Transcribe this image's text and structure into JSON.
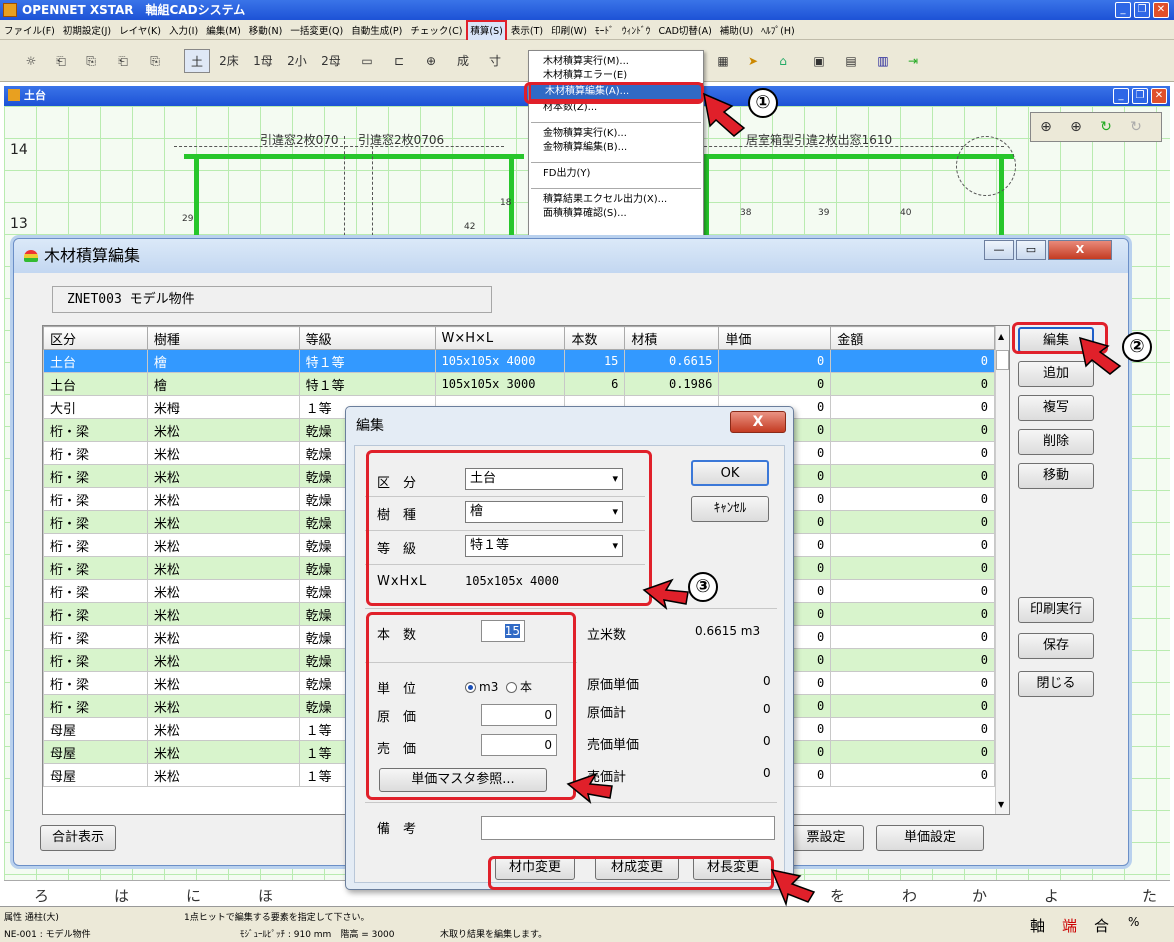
{
  "app": {
    "title": "OPENNET XSTAR　軸組CADシステム"
  },
  "menubar": [
    "ファイル(F)",
    "初期設定(J)",
    "レイヤ(K)",
    "入力(I)",
    "編集(M)",
    "移動(N)",
    "一括変更(Q)",
    "自動生成(P)",
    "チェック(C)",
    "積算(S)",
    "表示(T)",
    "印刷(W)",
    "ﾓｰﾄﾞ",
    "ｳｨﾝﾄﾞｳ",
    "CAD切替(A)",
    "補助(U)",
    "ﾍﾙﾌﾟ(H)"
  ],
  "toolbar": [
    "土",
    "2床",
    "1母",
    "2小",
    "2母",
    "成",
    "寸"
  ],
  "drop_menu": {
    "items": [
      "木材積算実行(M)...",
      "木材積算エラー(E)",
      "木材積算編集(A)...",
      "材本数(Z)...",
      "金物積算実行(K)...",
      "金物積算編集(B)...",
      "FD出力(Y)",
      "積算結果エクセル出力(X)...",
      "面積積算確認(S)..."
    ]
  },
  "doc": {
    "title": "土台"
  },
  "cad": {
    "row_labels": [
      "14",
      "13"
    ],
    "texts": [
      "引違窓2枚070",
      "引違窓2枚0706",
      "居室箱型引違2枚出窓1610"
    ],
    "kana": [
      "ろ",
      "は",
      "に",
      "ほ",
      "を",
      "わ",
      "か",
      "よ",
      "た"
    ],
    "nums": [
      "29",
      "42",
      "38",
      "39",
      "40",
      "18"
    ]
  },
  "zoom_palette": [
    "⊕",
    "⊕",
    "↻",
    "↻"
  ],
  "wood_dialog": {
    "title": "木材積算編集",
    "project": "ZNET003 モデル物件",
    "headers": [
      "区分",
      "樹種",
      "等級",
      "W×H×L",
      "本数",
      "材積",
      "単価",
      "金額"
    ],
    "rows": [
      {
        "kubun": "土台",
        "jushu": "檜",
        "tokyu": "特１等",
        "size": "105x105x 4000",
        "hon": "15",
        "zaiseki": "0.6615",
        "tanka": "0",
        "kingaku": "0"
      },
      {
        "kubun": "土台",
        "jushu": "檜",
        "tokyu": "特１等",
        "size": "105x105x 3000",
        "hon": "6",
        "zaiseki": "0.1986",
        "tanka": "0",
        "kingaku": "0"
      },
      {
        "kubun": "大引",
        "jushu": "米栂",
        "tokyu": "１等",
        "size": "",
        "hon": "",
        "zaiseki": "",
        "tanka": "0",
        "kingaku": "0"
      },
      {
        "kubun": "桁・梁",
        "jushu": "米松",
        "tokyu": "乾燥",
        "size": "",
        "hon": "",
        "zaiseki": "",
        "tanka": "0",
        "kingaku": "0"
      },
      {
        "kubun": "桁・梁",
        "jushu": "米松",
        "tokyu": "乾燥",
        "size": "",
        "hon": "",
        "zaiseki": "",
        "tanka": "0",
        "kingaku": "0"
      },
      {
        "kubun": "桁・梁",
        "jushu": "米松",
        "tokyu": "乾燥",
        "size": "",
        "hon": "",
        "zaiseki": "",
        "tanka": "0",
        "kingaku": "0"
      },
      {
        "kubun": "桁・梁",
        "jushu": "米松",
        "tokyu": "乾燥",
        "size": "",
        "hon": "",
        "zaiseki": "",
        "tanka": "0",
        "kingaku": "0"
      },
      {
        "kubun": "桁・梁",
        "jushu": "米松",
        "tokyu": "乾燥",
        "size": "",
        "hon": "",
        "zaiseki": "",
        "tanka": "0",
        "kingaku": "0"
      },
      {
        "kubun": "桁・梁",
        "jushu": "米松",
        "tokyu": "乾燥",
        "size": "",
        "hon": "",
        "zaiseki": "",
        "tanka": "0",
        "kingaku": "0"
      },
      {
        "kubun": "桁・梁",
        "jushu": "米松",
        "tokyu": "乾燥",
        "size": "",
        "hon": "",
        "zaiseki": "",
        "tanka": "0",
        "kingaku": "0"
      },
      {
        "kubun": "桁・梁",
        "jushu": "米松",
        "tokyu": "乾燥",
        "size": "",
        "hon": "",
        "zaiseki": "",
        "tanka": "0",
        "kingaku": "0"
      },
      {
        "kubun": "桁・梁",
        "jushu": "米松",
        "tokyu": "乾燥",
        "size": "",
        "hon": "",
        "zaiseki": "",
        "tanka": "0",
        "kingaku": "0"
      },
      {
        "kubun": "桁・梁",
        "jushu": "米松",
        "tokyu": "乾燥",
        "size": "",
        "hon": "",
        "zaiseki": "",
        "tanka": "0",
        "kingaku": "0"
      },
      {
        "kubun": "桁・梁",
        "jushu": "米松",
        "tokyu": "乾燥",
        "size": "",
        "hon": "",
        "zaiseki": "",
        "tanka": "0",
        "kingaku": "0"
      },
      {
        "kubun": "桁・梁",
        "jushu": "米松",
        "tokyu": "乾燥",
        "size": "",
        "hon": "",
        "zaiseki": "",
        "tanka": "0",
        "kingaku": "0"
      },
      {
        "kubun": "桁・梁",
        "jushu": "米松",
        "tokyu": "乾燥",
        "size": "",
        "hon": "",
        "zaiseki": "",
        "tanka": "0",
        "kingaku": "0"
      },
      {
        "kubun": "母屋",
        "jushu": "米松",
        "tokyu": "１等",
        "size": "",
        "hon": "",
        "zaiseki": "",
        "tanka": "0",
        "kingaku": "0"
      },
      {
        "kubun": "母屋",
        "jushu": "米松",
        "tokyu": "１等",
        "size": "",
        "hon": "",
        "zaiseki": "",
        "tanka": "0",
        "kingaku": "0"
      },
      {
        "kubun": "母屋",
        "jushu": "米松",
        "tokyu": "１等",
        "size": "",
        "hon": "",
        "zaiseki": "",
        "tanka": "0",
        "kingaku": "0"
      }
    ],
    "side_buttons": [
      "編集",
      "追加",
      "複写",
      "削除",
      "移動",
      "印刷実行",
      "保存",
      "閉じる"
    ],
    "bottom": {
      "total": "合計表示",
      "hyo": "票設定",
      "tanka": "単価設定"
    }
  },
  "edit_dialog": {
    "title": "編集",
    "kubun_label": "区　分",
    "kubun": "土台",
    "jushu_label": "樹　種",
    "jushu": "檜",
    "tokyu_label": "等　級",
    "tokyu": "特１等",
    "whl_label": "WxHxL",
    "whl": "105x105x 4000",
    "ok": "OK",
    "cancel": "ｷｬﾝｾﾙ",
    "honsu_label": "本　数",
    "honsu": "15",
    "rippo_label": "立米数",
    "rippo": "0.6615 m3",
    "tani_label": "単　位",
    "tani_m3": "m3",
    "tani_hon": "本",
    "gen_label": "原　価",
    "gen": "0",
    "uri_label": "売　価",
    "uri": "0",
    "gen_tanka_label": "原価単価",
    "gen_tanka": "0",
    "gen_kei_label": "原価計",
    "gen_kei": "0",
    "uri_tanka_label": "売価単価",
    "uri_tanka": "0",
    "uri_kei_label": "売価計",
    "uri_kei": "0",
    "master_btn": "単価マスタ参照...",
    "biko_label": "備　考",
    "btn_haba": "材巾変更",
    "btn_sei": "材成変更",
    "btn_cho": "材長変更"
  },
  "annotations": [
    "①",
    "②",
    "③"
  ],
  "status": {
    "l1": "属性 通柱(大)",
    "l2": "NE-001 : モデル物件",
    "m1": "1点ヒットで編集する要素を指定して下さい。",
    "m2": "ﾓｼﾞｭｰﾙﾋﾟｯﾁ : 910 mm　階高 = 3000",
    "m3": "木取り結果を編集します。",
    "modes": [
      "軸",
      "端",
      "合",
      "%"
    ]
  },
  "colors": {
    "selected_row": "#3399ff",
    "green_row": "#d8f4cc",
    "annotation_red": "#e0202a",
    "title_blue": "#1d52d6"
  }
}
